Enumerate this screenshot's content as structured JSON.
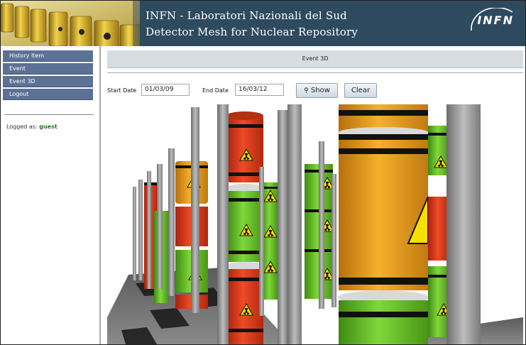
{
  "header": {
    "title_line1": "INFN - Laboratori Nazionali del Sud",
    "title_line2": "Detector Mesh for Nuclear Repository",
    "logo": "INFN"
  },
  "sidebar": {
    "items": [
      {
        "label": "History Item"
      },
      {
        "label": "Event"
      },
      {
        "label": "Event 3D"
      },
      {
        "label": "Logout"
      }
    ],
    "logged_label": "Logged as:",
    "logged_user": "guest"
  },
  "main": {
    "title": "Event 3D",
    "start_date_label": "Start Date",
    "start_date_value": "01/03/09",
    "end_date_label": "End Date",
    "end_date_value": "16/03/12",
    "show_label": "Show",
    "clear_label": "Clear"
  },
  "colors": {
    "header_bg": "#2e4a5e",
    "nav_bg": "#5b7196",
    "barrel_orange": "#f0a21e",
    "barrel_red": "#e23a1c",
    "barrel_green": "#6ac62a",
    "pole_gray": "#9a9a9a"
  }
}
